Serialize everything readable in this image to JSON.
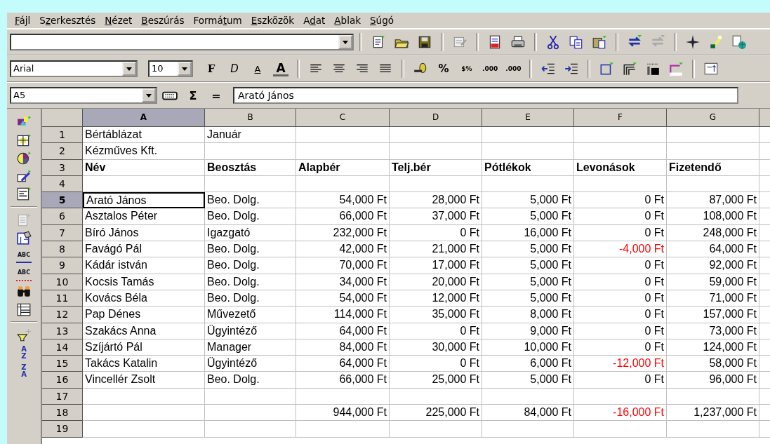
{
  "menu": [
    {
      "key": "F",
      "after": "ájl"
    },
    {
      "before": "S",
      "key": "z",
      "after": "erkesztés"
    },
    {
      "key": "N",
      "after": "ézet"
    },
    {
      "key": "B",
      "after": "eszúrás"
    },
    {
      "before": "Formá",
      "key": "t",
      "after": "um"
    },
    {
      "key": "E",
      "after": "szközök"
    },
    {
      "before": "A",
      "key": "d",
      "after": "at"
    },
    {
      "key": "A",
      "after": "blak"
    },
    {
      "key": "S",
      "after": "úgó"
    }
  ],
  "formatting": {
    "font": "Arial",
    "size": "10",
    "style_buttons": [
      "F",
      "D",
      "A",
      "A"
    ],
    "number_buttons": [
      "%",
      "$%",
      ".000",
      ".000"
    ]
  },
  "formula_bar": {
    "name_box": "A5",
    "sum_sign": "Σ",
    "equals": "=",
    "value": "Arató János"
  },
  "side_toolbar": {
    "spell_labels": [
      "ABC",
      "ABC"
    ],
    "sort_labels": [
      [
        "A",
        "Z"
      ],
      [
        "Z",
        "A"
      ]
    ]
  },
  "columns": [
    {
      "label": "A",
      "selected": true
    },
    {
      "label": "B",
      "selected": false
    },
    {
      "label": "C",
      "selected": false
    },
    {
      "label": "D",
      "selected": false
    },
    {
      "label": "E",
      "selected": false
    },
    {
      "label": "F",
      "selected": false
    },
    {
      "label": "G",
      "selected": false
    }
  ],
  "rows": [
    {
      "number": "1",
      "selected": false,
      "cells": [
        "Bértáblázat",
        "Január",
        "",
        "",
        "",
        "",
        ""
      ]
    },
    {
      "number": "2",
      "selected": false,
      "cells": [
        "Kézműves Kft.",
        "",
        "",
        "",
        "",
        "",
        ""
      ]
    },
    {
      "number": "3",
      "selected": false,
      "bold": true,
      "cells": [
        "Név",
        "Beosztás",
        "Alapbér",
        "Telj.bér",
        "Pótlékok",
        "Levonások",
        "Fizetendő"
      ]
    },
    {
      "number": "4",
      "selected": false,
      "cells": [
        "",
        "",
        "",
        "",
        "",
        "",
        ""
      ]
    },
    {
      "number": "5",
      "selected": true,
      "cells": [
        "Arató János",
        "Beo. Dolg.",
        "54,000 Ft",
        "28,000 Ft",
        "5,000 Ft",
        "0 Ft",
        "87,000 Ft"
      ]
    },
    {
      "number": "6",
      "selected": false,
      "cells": [
        "Asztalos Péter",
        "Beo. Dolg.",
        "66,000 Ft",
        "37,000 Ft",
        "5,000 Ft",
        "0 Ft",
        "108,000 Ft"
      ]
    },
    {
      "number": "7",
      "selected": false,
      "cells": [
        "Bíró János",
        "Igazgató",
        "232,000 Ft",
        "0 Ft",
        "16,000 Ft",
        "0 Ft",
        "248,000 Ft"
      ]
    },
    {
      "number": "8",
      "selected": false,
      "cells": [
        "Favágó Pál",
        "Beo. Dolg.",
        "42,000 Ft",
        "21,000 Ft",
        "5,000 Ft",
        {
          "text": "-4,000 Ft",
          "negative": true
        },
        "64,000 Ft"
      ]
    },
    {
      "number": "9",
      "selected": false,
      "cells": [
        "Kádár istván",
        "Beo. Dolg.",
        "70,000 Ft",
        "17,000 Ft",
        "5,000 Ft",
        "0 Ft",
        "92,000 Ft"
      ]
    },
    {
      "number": "10",
      "selected": false,
      "cells": [
        "Kocsis Tamás",
        "Beo. Dolg.",
        "34,000 Ft",
        "20,000 Ft",
        "5,000 Ft",
        "0 Ft",
        "59,000 Ft"
      ]
    },
    {
      "number": "11",
      "selected": false,
      "cells": [
        "Kovács Béla",
        "Beo. Dolg.",
        "54,000 Ft",
        "12,000 Ft",
        "5,000 Ft",
        "0 Ft",
        "71,000 Ft"
      ]
    },
    {
      "number": "12",
      "selected": false,
      "cells": [
        "Pap Dénes",
        "Művezető",
        "114,000 Ft",
        "35,000 Ft",
        "8,000 Ft",
        "0 Ft",
        "157,000 Ft"
      ]
    },
    {
      "number": "13",
      "selected": false,
      "cells": [
        "Szakács Anna",
        "Ügyintéző",
        "64,000 Ft",
        "0 Ft",
        "9,000 Ft",
        "0 Ft",
        "73,000 Ft"
      ]
    },
    {
      "number": "14",
      "selected": false,
      "cells": [
        "Szíjártó Pál",
        "Manager",
        "84,000 Ft",
        "30,000 Ft",
        "10,000 Ft",
        "0 Ft",
        "124,000 Ft"
      ]
    },
    {
      "number": "15",
      "selected": false,
      "cells": [
        "Takács Katalin",
        "Ügyintéző",
        "64,000 Ft",
        "0 Ft",
        "6,000 Ft",
        {
          "text": "-12,000 Ft",
          "negative": true
        },
        "58,000 Ft"
      ]
    },
    {
      "number": "16",
      "selected": false,
      "cells": [
        "Vincellér Zsolt",
        "Beo. Dolg.",
        "66,000 Ft",
        "25,000 Ft",
        "5,000 Ft",
        "0 Ft",
        "96,000 Ft"
      ]
    },
    {
      "number": "17",
      "selected": false,
      "cells": [
        "",
        "",
        "",
        "",
        "",
        "",
        ""
      ]
    },
    {
      "number": "18",
      "selected": false,
      "cells": [
        "",
        "",
        "944,000 Ft",
        "225,000 Ft",
        "84,000 Ft",
        {
          "text": "-16,000 Ft",
          "negative": true
        },
        "1,237,000 Ft"
      ]
    },
    {
      "number": "19",
      "selected": false,
      "cells": [
        "",
        "",
        "",
        "",
        "",
        "",
        ""
      ]
    }
  ]
}
